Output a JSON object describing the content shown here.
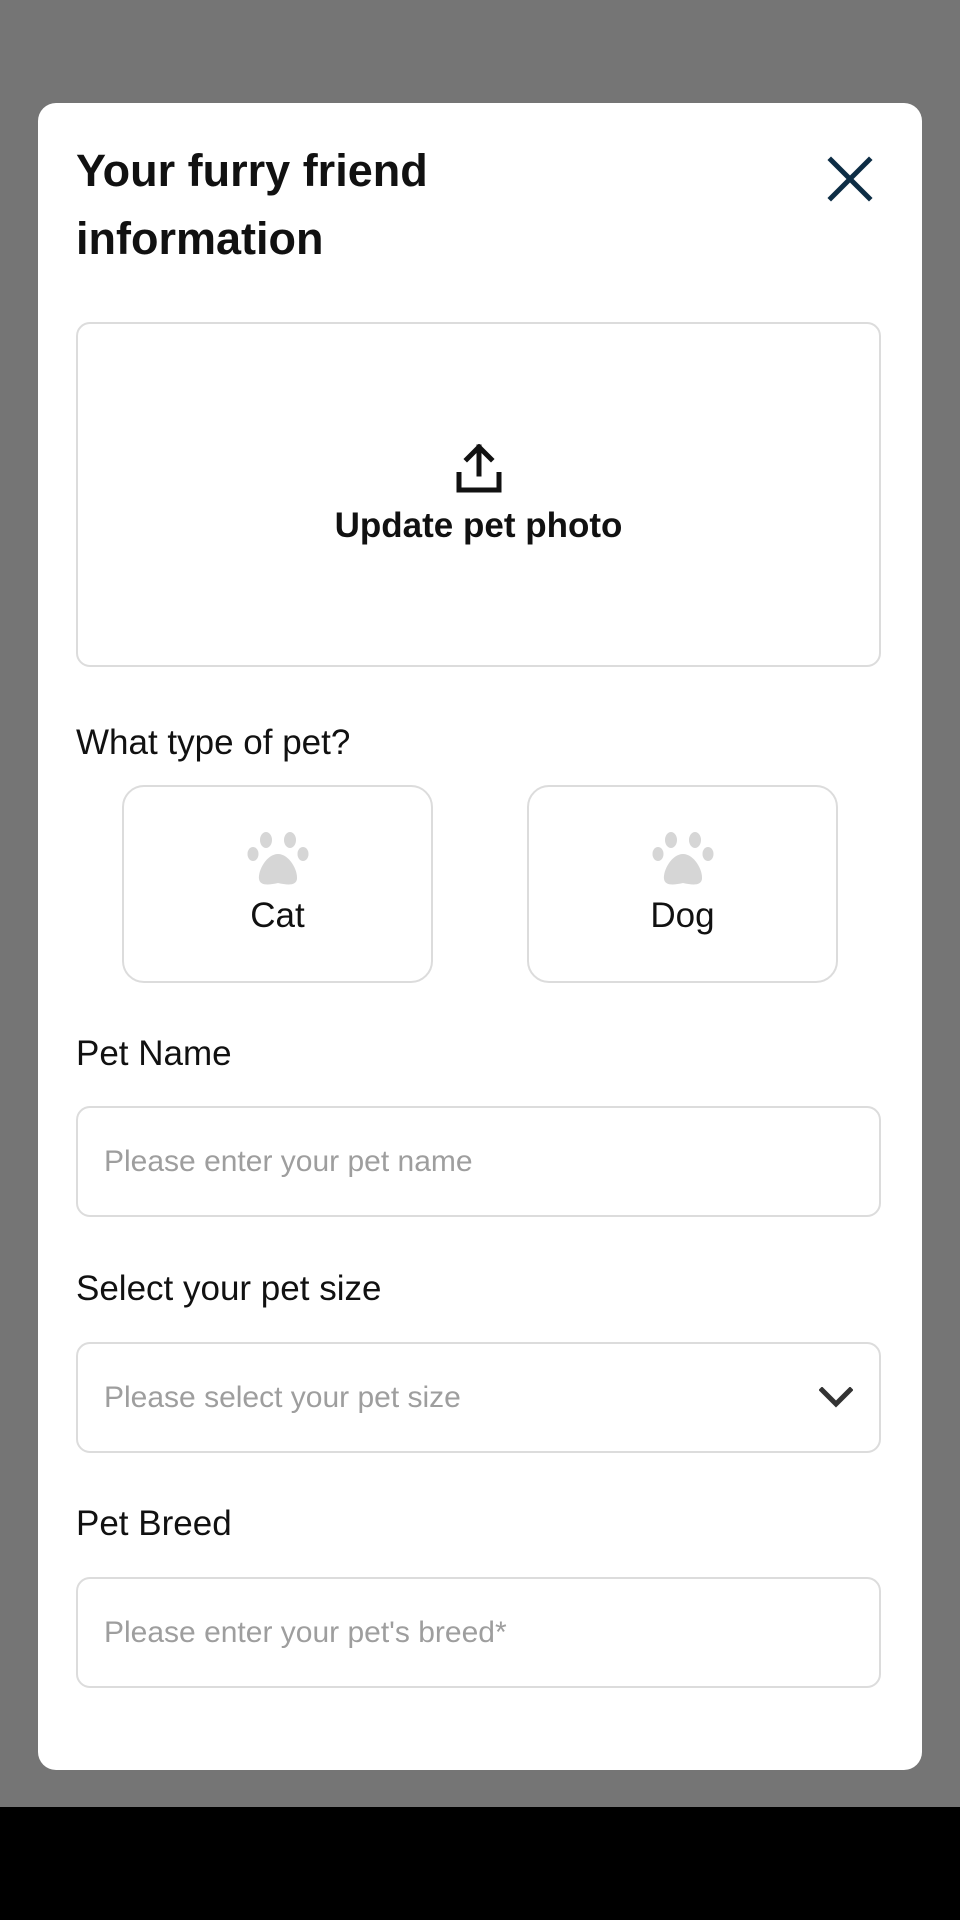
{
  "modal": {
    "title": "Your furry friend information",
    "close_icon": "close-icon"
  },
  "upload": {
    "icon": "upload-icon",
    "label": "Update pet photo"
  },
  "pet_type": {
    "question": "What type of pet?",
    "options": [
      {
        "label": "Cat",
        "icon": "paw-icon"
      },
      {
        "label": "Dog",
        "icon": "paw-icon"
      }
    ]
  },
  "pet_name": {
    "label": "Pet Name",
    "placeholder": "Please enter your pet name"
  },
  "pet_size": {
    "label": "Select your pet size",
    "placeholder": "Please select your pet size",
    "icon": "chevron-down-icon"
  },
  "pet_breed": {
    "label": "Pet Breed",
    "placeholder": "Please enter your pet's breed*"
  },
  "colors": {
    "overlay": "#757575",
    "close_icon": "#0d2d45",
    "paw_icon": "#d6d6d6",
    "border": "#dcdcdc",
    "placeholder": "#9e9e9e"
  }
}
